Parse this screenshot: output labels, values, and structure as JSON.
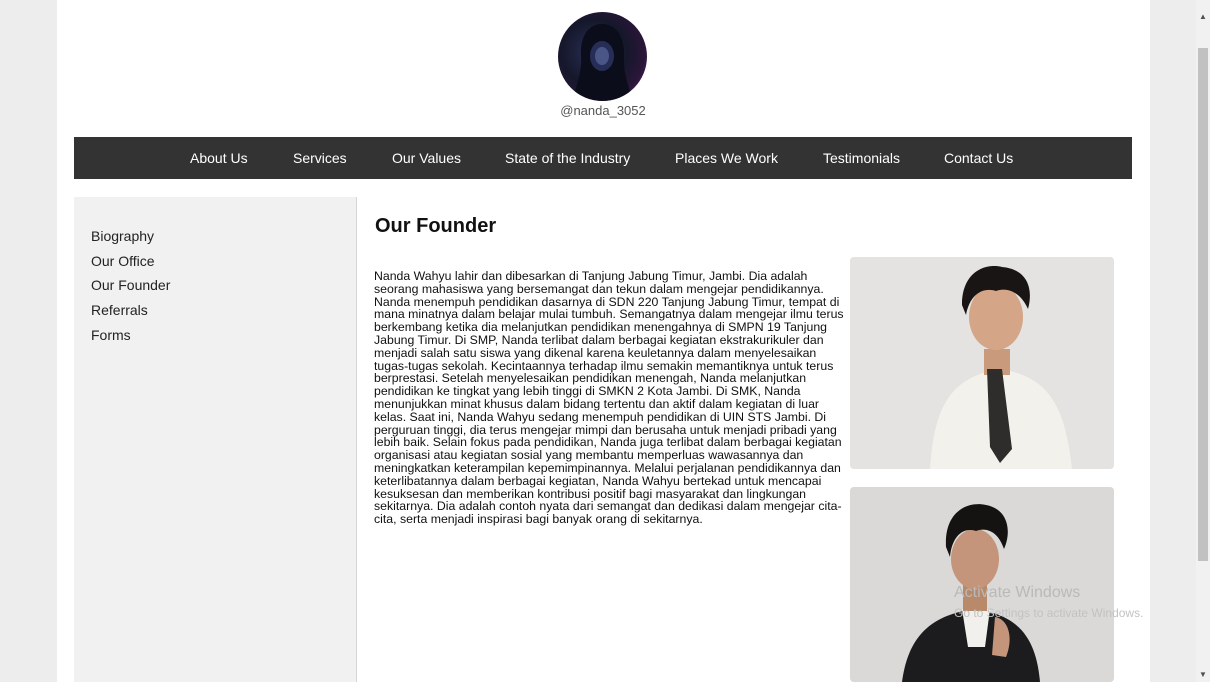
{
  "profile": {
    "username": "@nanda_3052"
  },
  "nav": {
    "items": [
      {
        "label": "About Us"
      },
      {
        "label": "Services"
      },
      {
        "label": "Our Values"
      },
      {
        "label": "State of the Industry"
      },
      {
        "label": "Places We Work"
      },
      {
        "label": "Testimonials"
      },
      {
        "label": "Contact Us"
      }
    ]
  },
  "sidebar": {
    "items": [
      {
        "label": "Biography"
      },
      {
        "label": "Our Office"
      },
      {
        "label": "Our Founder"
      },
      {
        "label": "Referrals"
      },
      {
        "label": "Forms"
      }
    ]
  },
  "main": {
    "title": "Our Founder",
    "bio": "Nanda Wahyu lahir dan dibesarkan di Tanjung Jabung Timur, Jambi. Dia adalah seorang mahasiswa yang bersemangat dan tekun dalam mengejar pendidikannya. Nanda menempuh pendidikan dasarnya di SDN 220 Tanjung Jabung Timur, tempat di mana minatnya dalam belajar mulai tumbuh. Semangatnya dalam mengejar ilmu terus berkembang ketika dia melanjutkan pendidikan menengahnya di SMPN 19 Tanjung Jabung Timur. Di SMP, Nanda terlibat dalam berbagai kegiatan ekstrakurikuler dan menjadi salah satu siswa yang dikenal karena keuletannya dalam menyelesaikan tugas-tugas sekolah. Kecintaannya terhadap ilmu semakin memantiknya untuk terus berprestasi. Setelah menyelesaikan pendidikan menengah, Nanda melanjutkan pendidikan ke tingkat yang lebih tinggi di SMKN 2 Kota Jambi. Di SMK, Nanda menunjukkan minat khusus dalam bidang tertentu dan aktif dalam kegiatan di luar kelas. Saat ini, Nanda Wahyu sedang menempuh pendidikan di UIN STS Jambi. Di perguruan tinggi, dia terus mengejar mimpi dan berusaha untuk menjadi pribadi yang lebih baik. Selain fokus pada pendidikan, Nanda juga terlibat dalam berbagai kegiatan organisasi atau kegiatan sosial yang membantu memperluas wawasannya dan meningkatkan keterampilan kepemimpinannya. Melalui perjalanan pendidikannya dan keterlibatannya dalam berbagai kegiatan, Nanda Wahyu bertekad untuk mencapai kesuksesan dan memberikan kontribusi positif bagi masyarakat dan lingkungan sekitarnya. Dia adalah contoh nyata dari semangat dan dedikasi dalam mengejar cita-cita, serta menjadi inspirasi bagi banyak orang di sekitarnya."
  },
  "watermark": {
    "title": "Activate Windows",
    "subtitle": "Go to Settings to activate Windows."
  },
  "icons": {
    "scroll_up": "scroll-up-arrow-icon",
    "scroll_down": "scroll-down-arrow-icon"
  }
}
